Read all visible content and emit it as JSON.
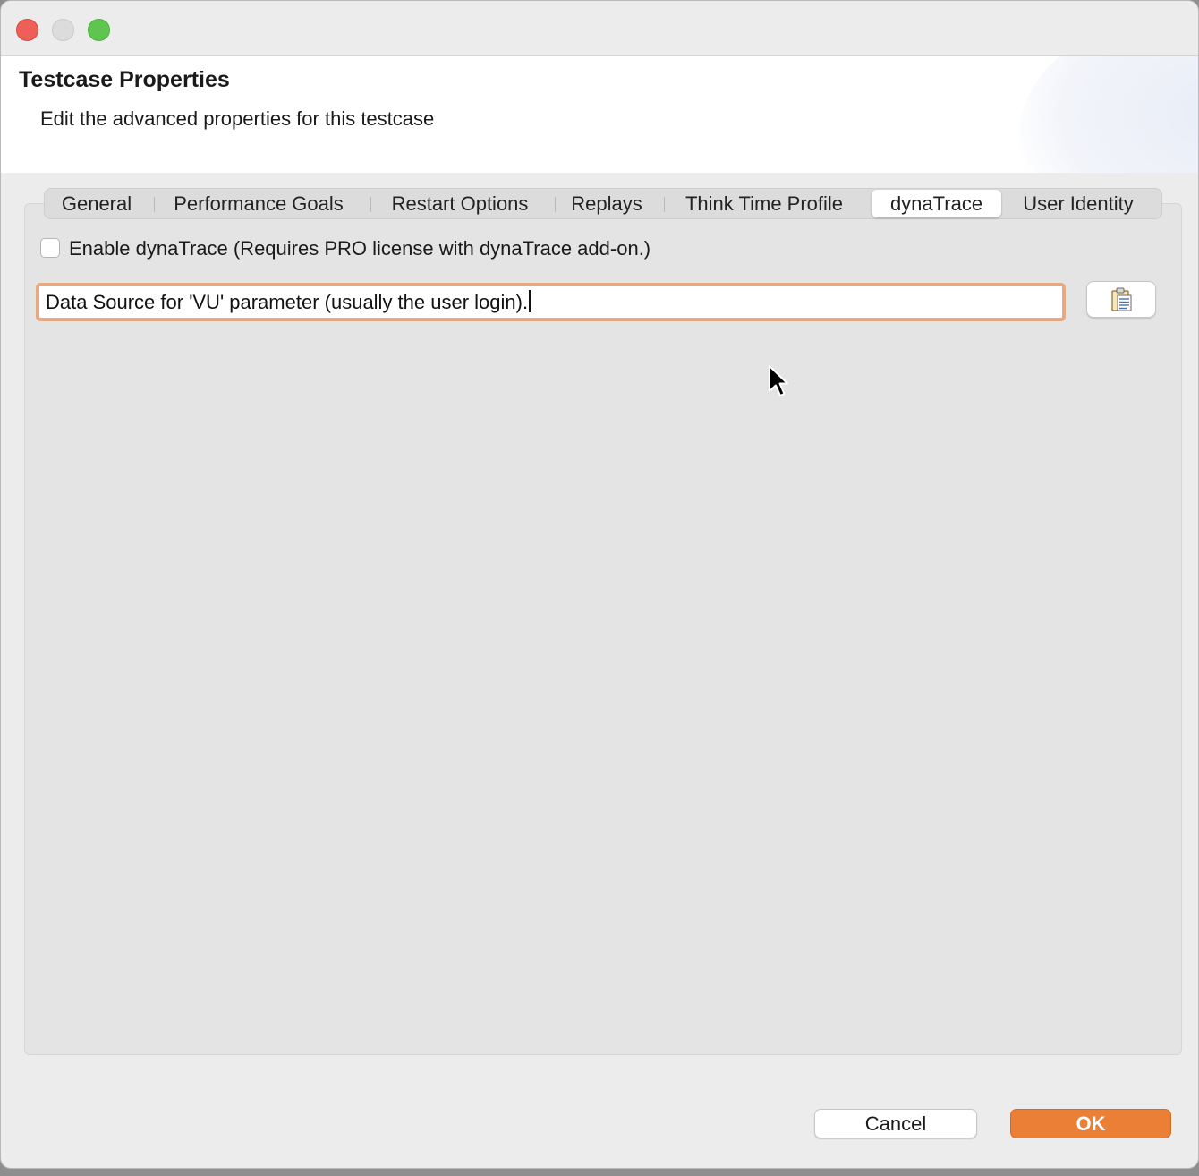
{
  "window": {
    "title": "Testcase Properties",
    "subtitle": "Edit the advanced properties for this testcase"
  },
  "tabs": [
    {
      "label": "General",
      "active": false
    },
    {
      "label": "Performance Goals",
      "active": false
    },
    {
      "label": "Restart Options",
      "active": false
    },
    {
      "label": "Replays",
      "active": false
    },
    {
      "label": "Think Time Profile",
      "active": false
    },
    {
      "label": "dynaTrace",
      "active": true
    },
    {
      "label": "User Identity",
      "active": false
    }
  ],
  "dynatrace": {
    "enable_label": "Enable dynaTrace (Requires PRO license with dynaTrace add-on.)",
    "enable_checked": false,
    "datasource_value": "Data Source for 'VU' parameter (usually the user login).",
    "datasource_button_icon": "clipboard-list-icon"
  },
  "buttons": {
    "cancel": "Cancel",
    "ok": "OK"
  },
  "colors": {
    "accent": "#ea7f35",
    "focus_ring": "#e8a97f"
  }
}
